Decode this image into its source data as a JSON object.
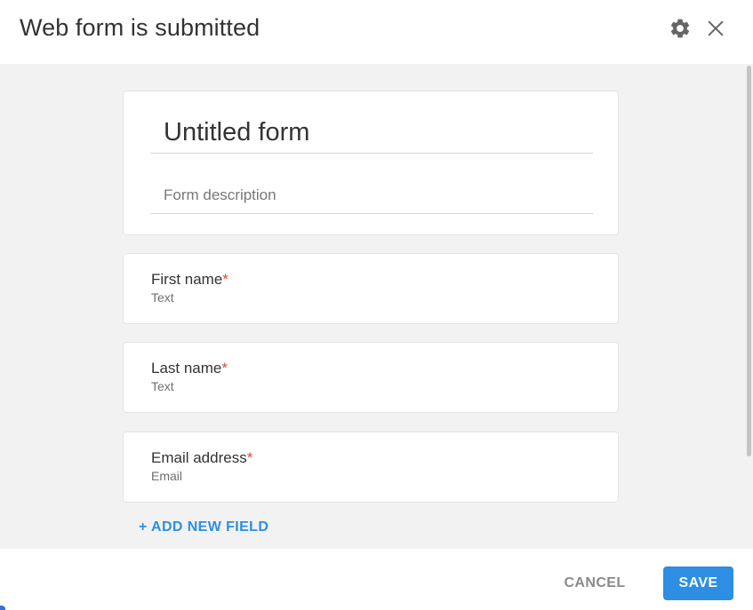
{
  "header": {
    "title": "Web form is submitted",
    "settings_icon": "gear-icon",
    "close_icon": "close-icon"
  },
  "form": {
    "title_value": "Untitled form",
    "description_placeholder": "Form description"
  },
  "fields": [
    {
      "label": "First name",
      "required_mark": "*",
      "type": "Text"
    },
    {
      "label": "Last name",
      "required_mark": "*",
      "type": "Text"
    },
    {
      "label": "Email address",
      "required_mark": "*",
      "type": "Email"
    }
  ],
  "add_field_label": "+ ADD NEW FIELD",
  "footer": {
    "cancel_label": "CANCEL",
    "save_label": "SAVE"
  },
  "colors": {
    "accent": "#2d8ee3",
    "required": "#e0453a",
    "background": "#f2f2f2"
  }
}
